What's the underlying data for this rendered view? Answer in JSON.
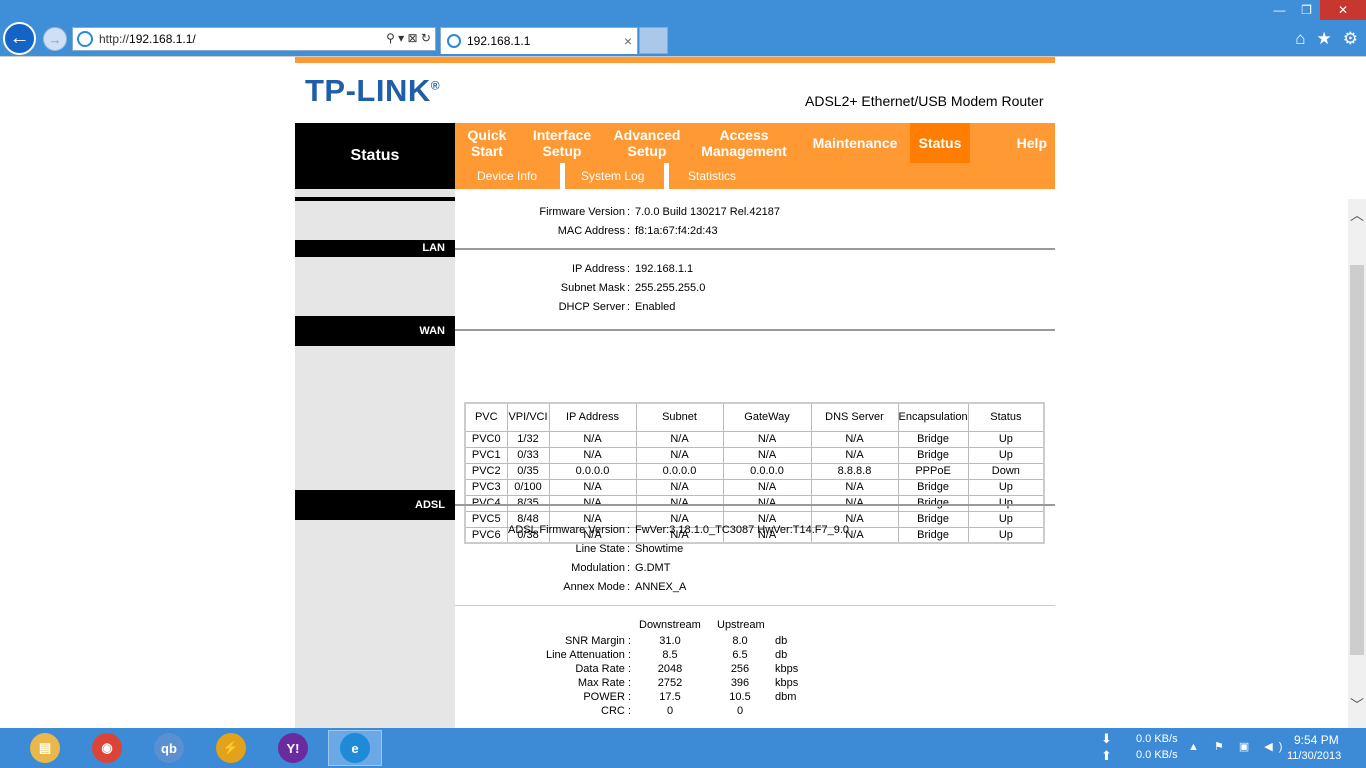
{
  "browser": {
    "url_prefix": "http://",
    "url_host": "192.168.1.1/",
    "tab_title": "192.168.1.1",
    "address_tools": "⚲ ▾ ⊠ ↻",
    "tab_close": "×",
    "win_minimize": "—",
    "win_restore": "❐",
    "win_close": "✕",
    "home_icon": "⌂",
    "favorites_icon": "★",
    "settings_icon": "⚙"
  },
  "header": {
    "logo": "TP-LINK",
    "logo_mark": "®",
    "product": "ADSL2+ Ethernet/USB Modem Router"
  },
  "nav": {
    "section_title": "Status",
    "menu": [
      {
        "label": "Quick Start"
      },
      {
        "label": "Interface Setup"
      },
      {
        "label": "Advanced Setup"
      },
      {
        "label": "Access Management"
      },
      {
        "label": "Maintenance"
      },
      {
        "label": "Status"
      },
      {
        "label": "Help"
      }
    ],
    "submenu": [
      {
        "label": "Device Info"
      },
      {
        "label": "System Log"
      },
      {
        "label": "Statistics"
      }
    ]
  },
  "sidebar": {
    "lan": "LAN",
    "wan": "WAN",
    "adsl": "ADSL"
  },
  "device": {
    "firmware_label": "Firmware Version",
    "firmware": "7.0.0 Build 130217 Rel.42187",
    "mac_label": "MAC Address",
    "mac": "f8:1a:67:f4:2d:43"
  },
  "lan": {
    "ip_label": "IP Address",
    "ip": "192.168.1.1",
    "mask_label": "Subnet Mask",
    "mask": "255.255.255.0",
    "dhcp_label": "DHCP Server",
    "dhcp": "Enabled"
  },
  "wan": {
    "headers": [
      "PVC",
      "VPI/VCI",
      "IP Address",
      "Subnet",
      "GateWay",
      "DNS Server",
      "Encapsulation",
      "Status"
    ],
    "rows": [
      [
        "PVC0",
        "1/32",
        "N/A",
        "N/A",
        "N/A",
        "N/A",
        "Bridge",
        "Up"
      ],
      [
        "PVC1",
        "0/33",
        "N/A",
        "N/A",
        "N/A",
        "N/A",
        "Bridge",
        "Up"
      ],
      [
        "PVC2",
        "0/35",
        "0.0.0.0",
        "0.0.0.0",
        "0.0.0.0",
        "8.8.8.8",
        "PPPoE",
        "Down"
      ],
      [
        "PVC3",
        "0/100",
        "N/A",
        "N/A",
        "N/A",
        "N/A",
        "Bridge",
        "Up"
      ],
      [
        "PVC4",
        "8/35",
        "N/A",
        "N/A",
        "N/A",
        "N/A",
        "Bridge",
        "Up"
      ],
      [
        "PVC5",
        "8/48",
        "N/A",
        "N/A",
        "N/A",
        "N/A",
        "Bridge",
        "Up"
      ],
      [
        "PVC6",
        "0/38",
        "N/A",
        "N/A",
        "N/A",
        "N/A",
        "Bridge",
        "Up"
      ]
    ]
  },
  "adsl": {
    "fw_label": "ADSL Firmware Version",
    "fw": "FwVer:3.18.1.0_TC3087 HwVer:T14.F7_9.0",
    "line_state_label": "Line State",
    "line_state": "Showtime",
    "modulation_label": "Modulation",
    "modulation": "G.DMT",
    "annex_label": "Annex Mode",
    "annex": "ANNEX_A",
    "downstream_header": "Downstream",
    "upstream_header": "Upstream",
    "stats": [
      {
        "label": "SNR Margin :",
        "down": "31.0",
        "up": "8.0",
        "unit": "db"
      },
      {
        "label": "Line Attenuation :",
        "down": "8.5",
        "up": "6.5",
        "unit": "db"
      },
      {
        "label": "Data Rate :",
        "down": "2048",
        "up": "256",
        "unit": "kbps"
      },
      {
        "label": "Max Rate :",
        "down": "2752",
        "up": "396",
        "unit": "kbps"
      },
      {
        "label": "POWER :",
        "down": "17.5",
        "up": "10.5",
        "unit": "dbm"
      },
      {
        "label": "CRC :",
        "down": "0",
        "up": "0",
        "unit": ""
      }
    ]
  },
  "taskbar": {
    "download_speed": "0.0 KB/s",
    "upload_speed": "0.0 KB/s",
    "time": "9:54 PM",
    "date": "11/30/2013",
    "tray_icons": "▲ ⚑ ▣ ◀)",
    "apps": [
      {
        "name": "file-explorer",
        "glyph": "▤",
        "color": "#e8b84a"
      },
      {
        "name": "chrome",
        "glyph": "◉",
        "color": "#db4437"
      },
      {
        "name": "qbittorrent",
        "glyph": "qb",
        "color": "#5a8fd0"
      },
      {
        "name": "winamp",
        "glyph": "⚡",
        "color": "#e3a21a"
      },
      {
        "name": "yahoo-messenger",
        "glyph": "Y!",
        "color": "#6b2b9e"
      },
      {
        "name": "internet-explorer",
        "glyph": "e",
        "color": "#1f8ad8"
      }
    ]
  }
}
